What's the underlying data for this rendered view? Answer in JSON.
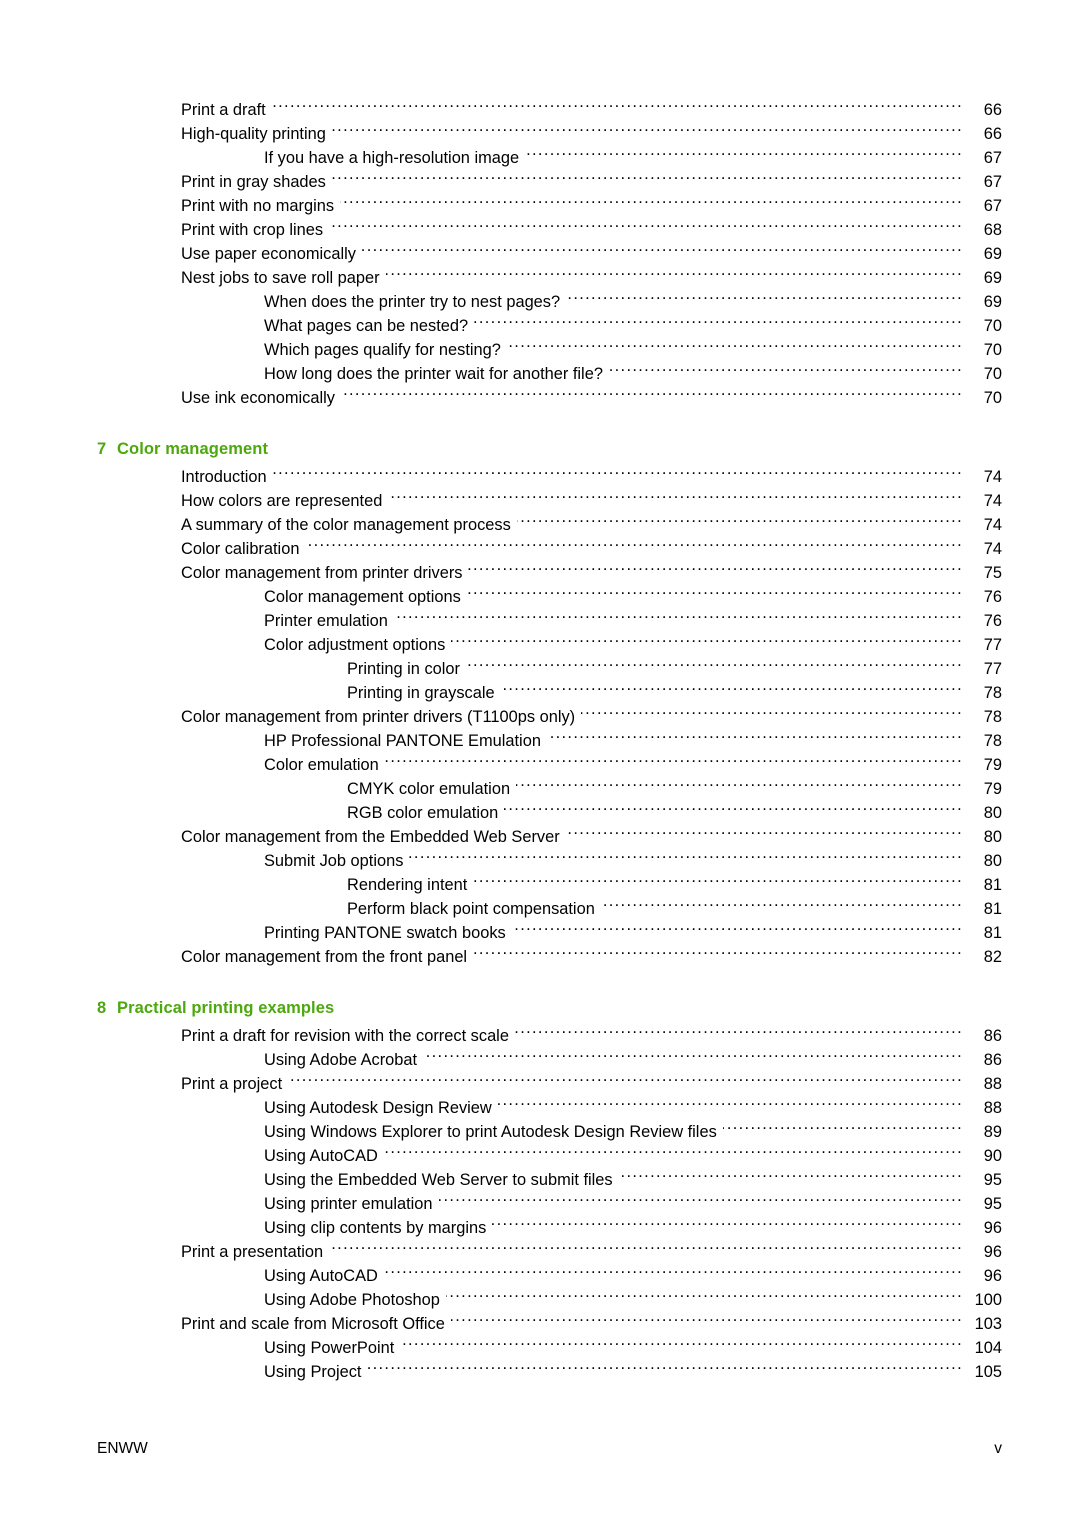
{
  "document": {
    "type": "table-of-contents",
    "accent_color": "#4CA80D",
    "text_color": "#000000",
    "background_color": "#ffffff"
  },
  "continued_section": {
    "entries": [
      {
        "label": "Print a draft",
        "page": "66",
        "level": 1
      },
      {
        "label": "High-quality printing",
        "page": "66",
        "level": 1
      },
      {
        "label": "If you have a high-resolution image",
        "page": "67",
        "level": 2
      },
      {
        "label": "Print in gray shades",
        "page": "67",
        "level": 1
      },
      {
        "label": "Print with no margins",
        "page": "67",
        "level": 1
      },
      {
        "label": "Print with crop lines",
        "page": "68",
        "level": 1
      },
      {
        "label": "Use paper economically",
        "page": "69",
        "level": 1
      },
      {
        "label": "Nest jobs to save roll paper",
        "page": "69",
        "level": 1
      },
      {
        "label": "When does the printer try to nest pages?",
        "page": "69",
        "level": 2
      },
      {
        "label": "What pages can be nested?",
        "page": "70",
        "level": 2
      },
      {
        "label": "Which pages qualify for nesting?",
        "page": "70",
        "level": 2
      },
      {
        "label": "How long does the printer wait for another file?",
        "page": "70",
        "level": 2
      },
      {
        "label": "Use ink economically",
        "page": "70",
        "level": 1
      }
    ]
  },
  "chapters": [
    {
      "number": "7",
      "title": "Color management",
      "entries": [
        {
          "label": "Introduction",
          "page": "74",
          "level": 1
        },
        {
          "label": "How colors are represented",
          "page": "74",
          "level": 1
        },
        {
          "label": "A summary of the color management process",
          "page": "74",
          "level": 1
        },
        {
          "label": "Color calibration",
          "page": "74",
          "level": 1
        },
        {
          "label": "Color management from printer drivers",
          "page": "75",
          "level": 1
        },
        {
          "label": "Color management options",
          "page": "76",
          "level": 2
        },
        {
          "label": "Printer emulation",
          "page": "76",
          "level": 2
        },
        {
          "label": "Color adjustment options",
          "page": "77",
          "level": 2
        },
        {
          "label": "Printing in color",
          "page": "77",
          "level": 3
        },
        {
          "label": "Printing in grayscale",
          "page": "78",
          "level": 3
        },
        {
          "label": "Color management from printer drivers (T1100ps only)",
          "page": "78",
          "level": 1
        },
        {
          "label": "HP Professional PANTONE Emulation",
          "page": "78",
          "level": 2
        },
        {
          "label": "Color emulation",
          "page": "79",
          "level": 2
        },
        {
          "label": "CMYK color emulation",
          "page": "79",
          "level": 3
        },
        {
          "label": "RGB color emulation",
          "page": "80",
          "level": 3
        },
        {
          "label": "Color management from the Embedded Web Server",
          "page": "80",
          "level": 1
        },
        {
          "label": "Submit Job options",
          "page": "80",
          "level": 2
        },
        {
          "label": "Rendering intent",
          "page": "81",
          "level": 3
        },
        {
          "label": "Perform black point compensation",
          "page": "81",
          "level": 3
        },
        {
          "label": "Printing PANTONE swatch books",
          "page": "81",
          "level": 2
        },
        {
          "label": "Color management from the front panel",
          "page": "82",
          "level": 1
        }
      ]
    },
    {
      "number": "8",
      "title": "Practical printing examples",
      "entries": [
        {
          "label": "Print a draft for revision with the correct scale",
          "page": "86",
          "level": 1
        },
        {
          "label": "Using Adobe Acrobat",
          "page": "86",
          "level": 2
        },
        {
          "label": "Print a project",
          "page": "88",
          "level": 1
        },
        {
          "label": "Using Autodesk Design Review",
          "page": "88",
          "level": 2
        },
        {
          "label": "Using Windows Explorer to print Autodesk Design Review files",
          "page": "89",
          "level": 2
        },
        {
          "label": "Using AutoCAD",
          "page": "90",
          "level": 2
        },
        {
          "label": "Using the Embedded Web Server to submit files",
          "page": "95",
          "level": 2
        },
        {
          "label": "Using printer emulation",
          "page": "95",
          "level": 2
        },
        {
          "label": "Using clip contents by margins",
          "page": "96",
          "level": 2
        },
        {
          "label": "Print a presentation",
          "page": "96",
          "level": 1
        },
        {
          "label": "Using AutoCAD",
          "page": "96",
          "level": 2
        },
        {
          "label": "Using Adobe Photoshop",
          "page": "100",
          "level": 2
        },
        {
          "label": "Print and scale from Microsoft Office",
          "page": "103",
          "level": 1
        },
        {
          "label": "Using PowerPoint",
          "page": "104",
          "level": 2
        },
        {
          "label": "Using Project",
          "page": "105",
          "level": 2
        }
      ]
    }
  ],
  "footer": {
    "left": "ENWW",
    "right": "v"
  }
}
